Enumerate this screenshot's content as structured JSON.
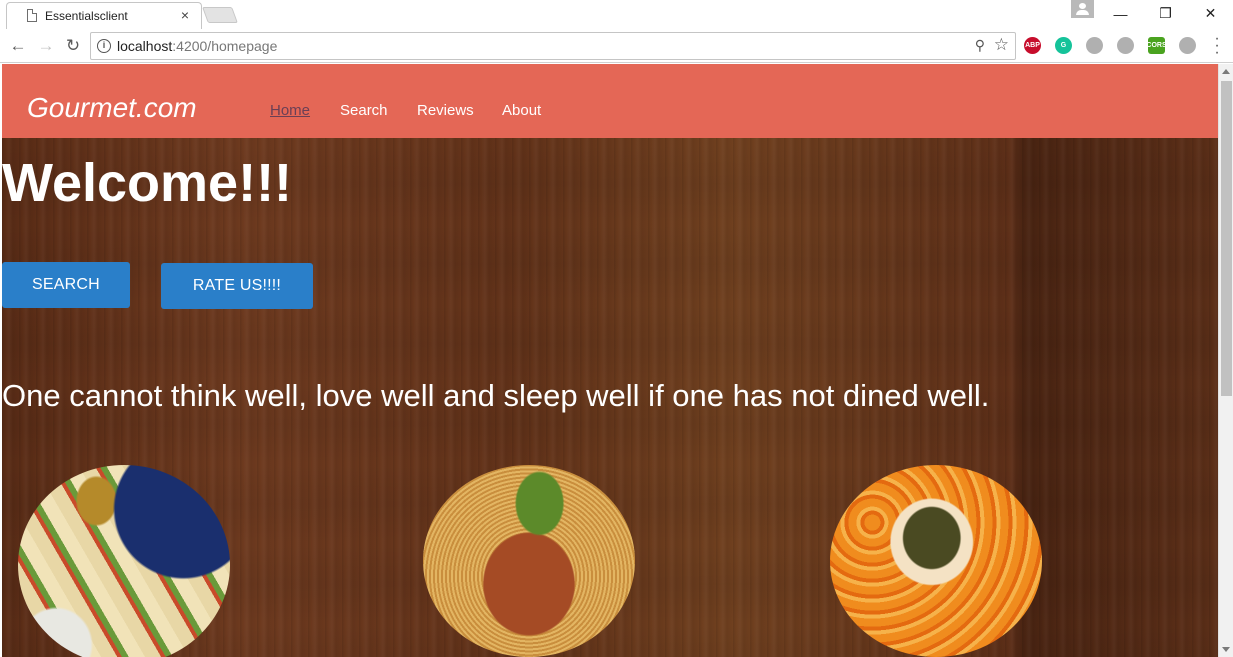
{
  "browser": {
    "tab_title": "Essentialsclient",
    "tab_close": "×",
    "url_host": "localhost",
    "url_rest": ":4200/homepage",
    "window_controls": {
      "minimize": "—",
      "restore": "❐",
      "close": "✕"
    },
    "nav": {
      "back": "←",
      "forward": "→",
      "reload": "↻"
    },
    "extensions": [
      {
        "name": "adblock-plus-icon",
        "label": "ABP",
        "color": "#c70d2c"
      },
      {
        "name": "grammarly-icon",
        "label": "G",
        "color": "#15c39a"
      },
      {
        "name": "extension-icon",
        "label": "",
        "color": "#b0b0b0"
      },
      {
        "name": "shield-icon",
        "label": "",
        "color": "#b0b0b0"
      },
      {
        "name": "cors-icon",
        "label": "CORS",
        "color": "#4aa31f"
      },
      {
        "name": "circle-ext-icon",
        "label": "",
        "color": "#b0b0b0"
      }
    ]
  },
  "site": {
    "brand": "Gourmet.com",
    "nav_links": [
      "Home",
      "Search",
      "Reviews",
      "About"
    ],
    "accent_color": "#e46756",
    "button_color": "#2a7fc9"
  },
  "hero": {
    "heading": "Welcome!!!",
    "search_button": "SEARCH",
    "rate_button": "RATE US!!!!",
    "quote": "One cannot think well, love well and sleep well if one has not dined well."
  },
  "dishes": [
    "tacos-image",
    "spaghetti-image",
    "snack-platter-image"
  ]
}
